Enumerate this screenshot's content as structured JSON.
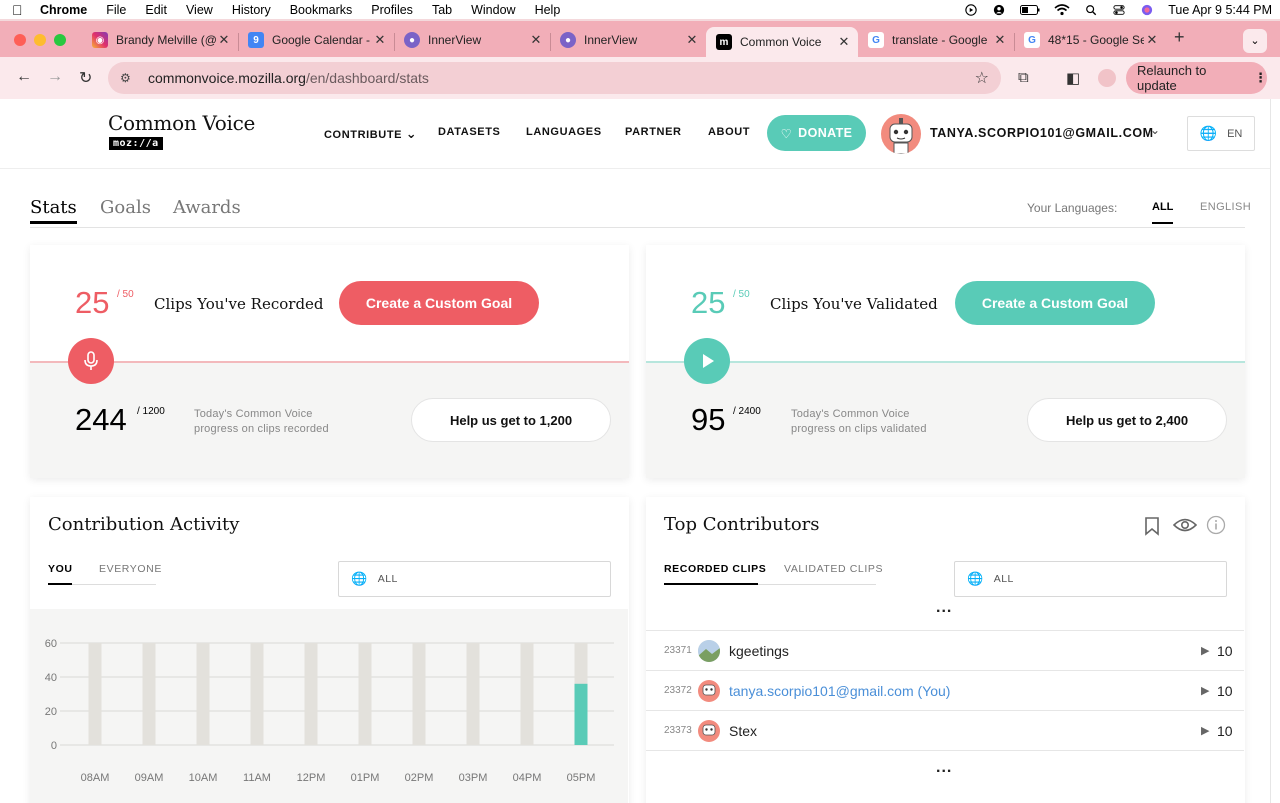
{
  "menubar": {
    "items": [
      "Chrome",
      "File",
      "Edit",
      "View",
      "History",
      "Bookmarks",
      "Profiles",
      "Tab",
      "Window",
      "Help"
    ],
    "datetime": "Tue Apr 9  5:44 PM"
  },
  "tabs": [
    {
      "title": "Brandy Melville (@",
      "icon": "instagram-icon"
    },
    {
      "title": "Google Calendar -",
      "icon": "calendar-icon"
    },
    {
      "title": "InnerView",
      "icon": "innerview-icon"
    },
    {
      "title": "InnerView",
      "icon": "innerview-icon"
    },
    {
      "title": "Common Voice",
      "icon": "mozilla-icon"
    },
    {
      "title": "translate - Google",
      "icon": "google-icon"
    },
    {
      "title": "48*15 - Google Se",
      "icon": "google-icon"
    }
  ],
  "address": {
    "host": "commonvoice.mozilla.org",
    "path": "/en/dashboard/stats"
  },
  "relaunch_label": "Relaunch to update",
  "site": {
    "logo_text": "Common Voice",
    "logo_badge": "moz://a",
    "nav": [
      "CONTRIBUTE",
      "DATASETS",
      "LANGUAGES",
      "PARTNER",
      "ABOUT"
    ],
    "donate_label": "DONATE",
    "user_email": "TANYA.SCORPIO101@GMAIL.COM",
    "lang_code": "EN"
  },
  "dashboard": {
    "tabs": [
      "Stats",
      "Goals",
      "Awards"
    ],
    "your_languages_label": "Your Languages:",
    "lang_tabs": [
      "ALL",
      "ENGLISH"
    ]
  },
  "recorded": {
    "count": "25",
    "goal": "/ 50",
    "label": "Clips You've Recorded",
    "button": "Create a Custom Goal",
    "today_count": "244",
    "today_goal": "/ 1200",
    "today_text": "Today's Common Voice progress on clips recorded",
    "help_button": "Help us get to 1,200",
    "accent": "#ee5d64"
  },
  "validated": {
    "count": "25",
    "goal": "/ 50",
    "label": "Clips You've Validated",
    "button": "Create a Custom Goal",
    "today_count": "95",
    "today_goal": "/ 2400",
    "today_text": "Today's Common Voice progress on clips validated",
    "help_button": "Help us get to 2,400",
    "accent": "#59cbb7"
  },
  "activity": {
    "title": "Contribution Activity",
    "tabs": [
      "YOU",
      "EVERYONE"
    ],
    "lang_select": "ALL"
  },
  "chart_data": {
    "type": "bar",
    "categories": [
      "08AM",
      "09AM",
      "10AM",
      "11AM",
      "12PM",
      "01PM",
      "02PM",
      "03PM",
      "04PM",
      "05PM"
    ],
    "values": [
      0,
      0,
      0,
      0,
      0,
      0,
      0,
      0,
      0,
      36
    ],
    "ylim": [
      0,
      60
    ],
    "yticks": [
      0,
      20,
      40,
      60
    ],
    "bar_color": "#59cbb7",
    "background_bar_color": "#e3e1dc"
  },
  "contributors": {
    "title": "Top Contributors",
    "tabs": [
      "RECORDED CLIPS",
      "VALIDATED CLIPS"
    ],
    "lang_select": "ALL",
    "ellipsis": "...",
    "rows": [
      {
        "rank": "23371",
        "name": "kgeetings",
        "count": "10"
      },
      {
        "rank": "23372",
        "name": "tanya.scorpio101@gmail.com (You)",
        "count": "10"
      },
      {
        "rank": "23373",
        "name": "Stex",
        "count": "10"
      }
    ]
  }
}
